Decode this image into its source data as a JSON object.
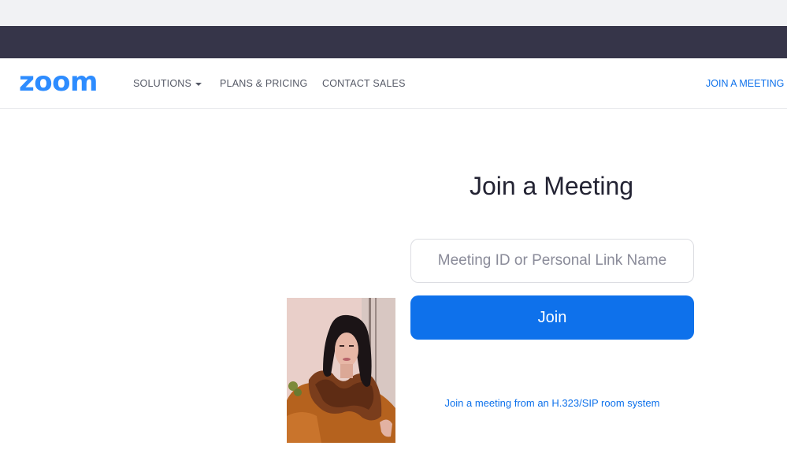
{
  "nav": {
    "logo": "zoom",
    "solutions": "SOLUTIONS",
    "plans": "PLANS & PRICING",
    "contact": "CONTACT SALES",
    "join": "JOIN A MEETING"
  },
  "main": {
    "title": "Join a Meeting",
    "meeting_input_placeholder": "Meeting ID or Personal Link Name",
    "meeting_input_value": "",
    "join_button": "Join",
    "sip_link": "Join a meeting from an H.323/SIP room system"
  },
  "colors": {
    "brand_blue": "#2d8cff",
    "button_blue": "#0e71eb",
    "top_bar_dark": "#363549"
  }
}
